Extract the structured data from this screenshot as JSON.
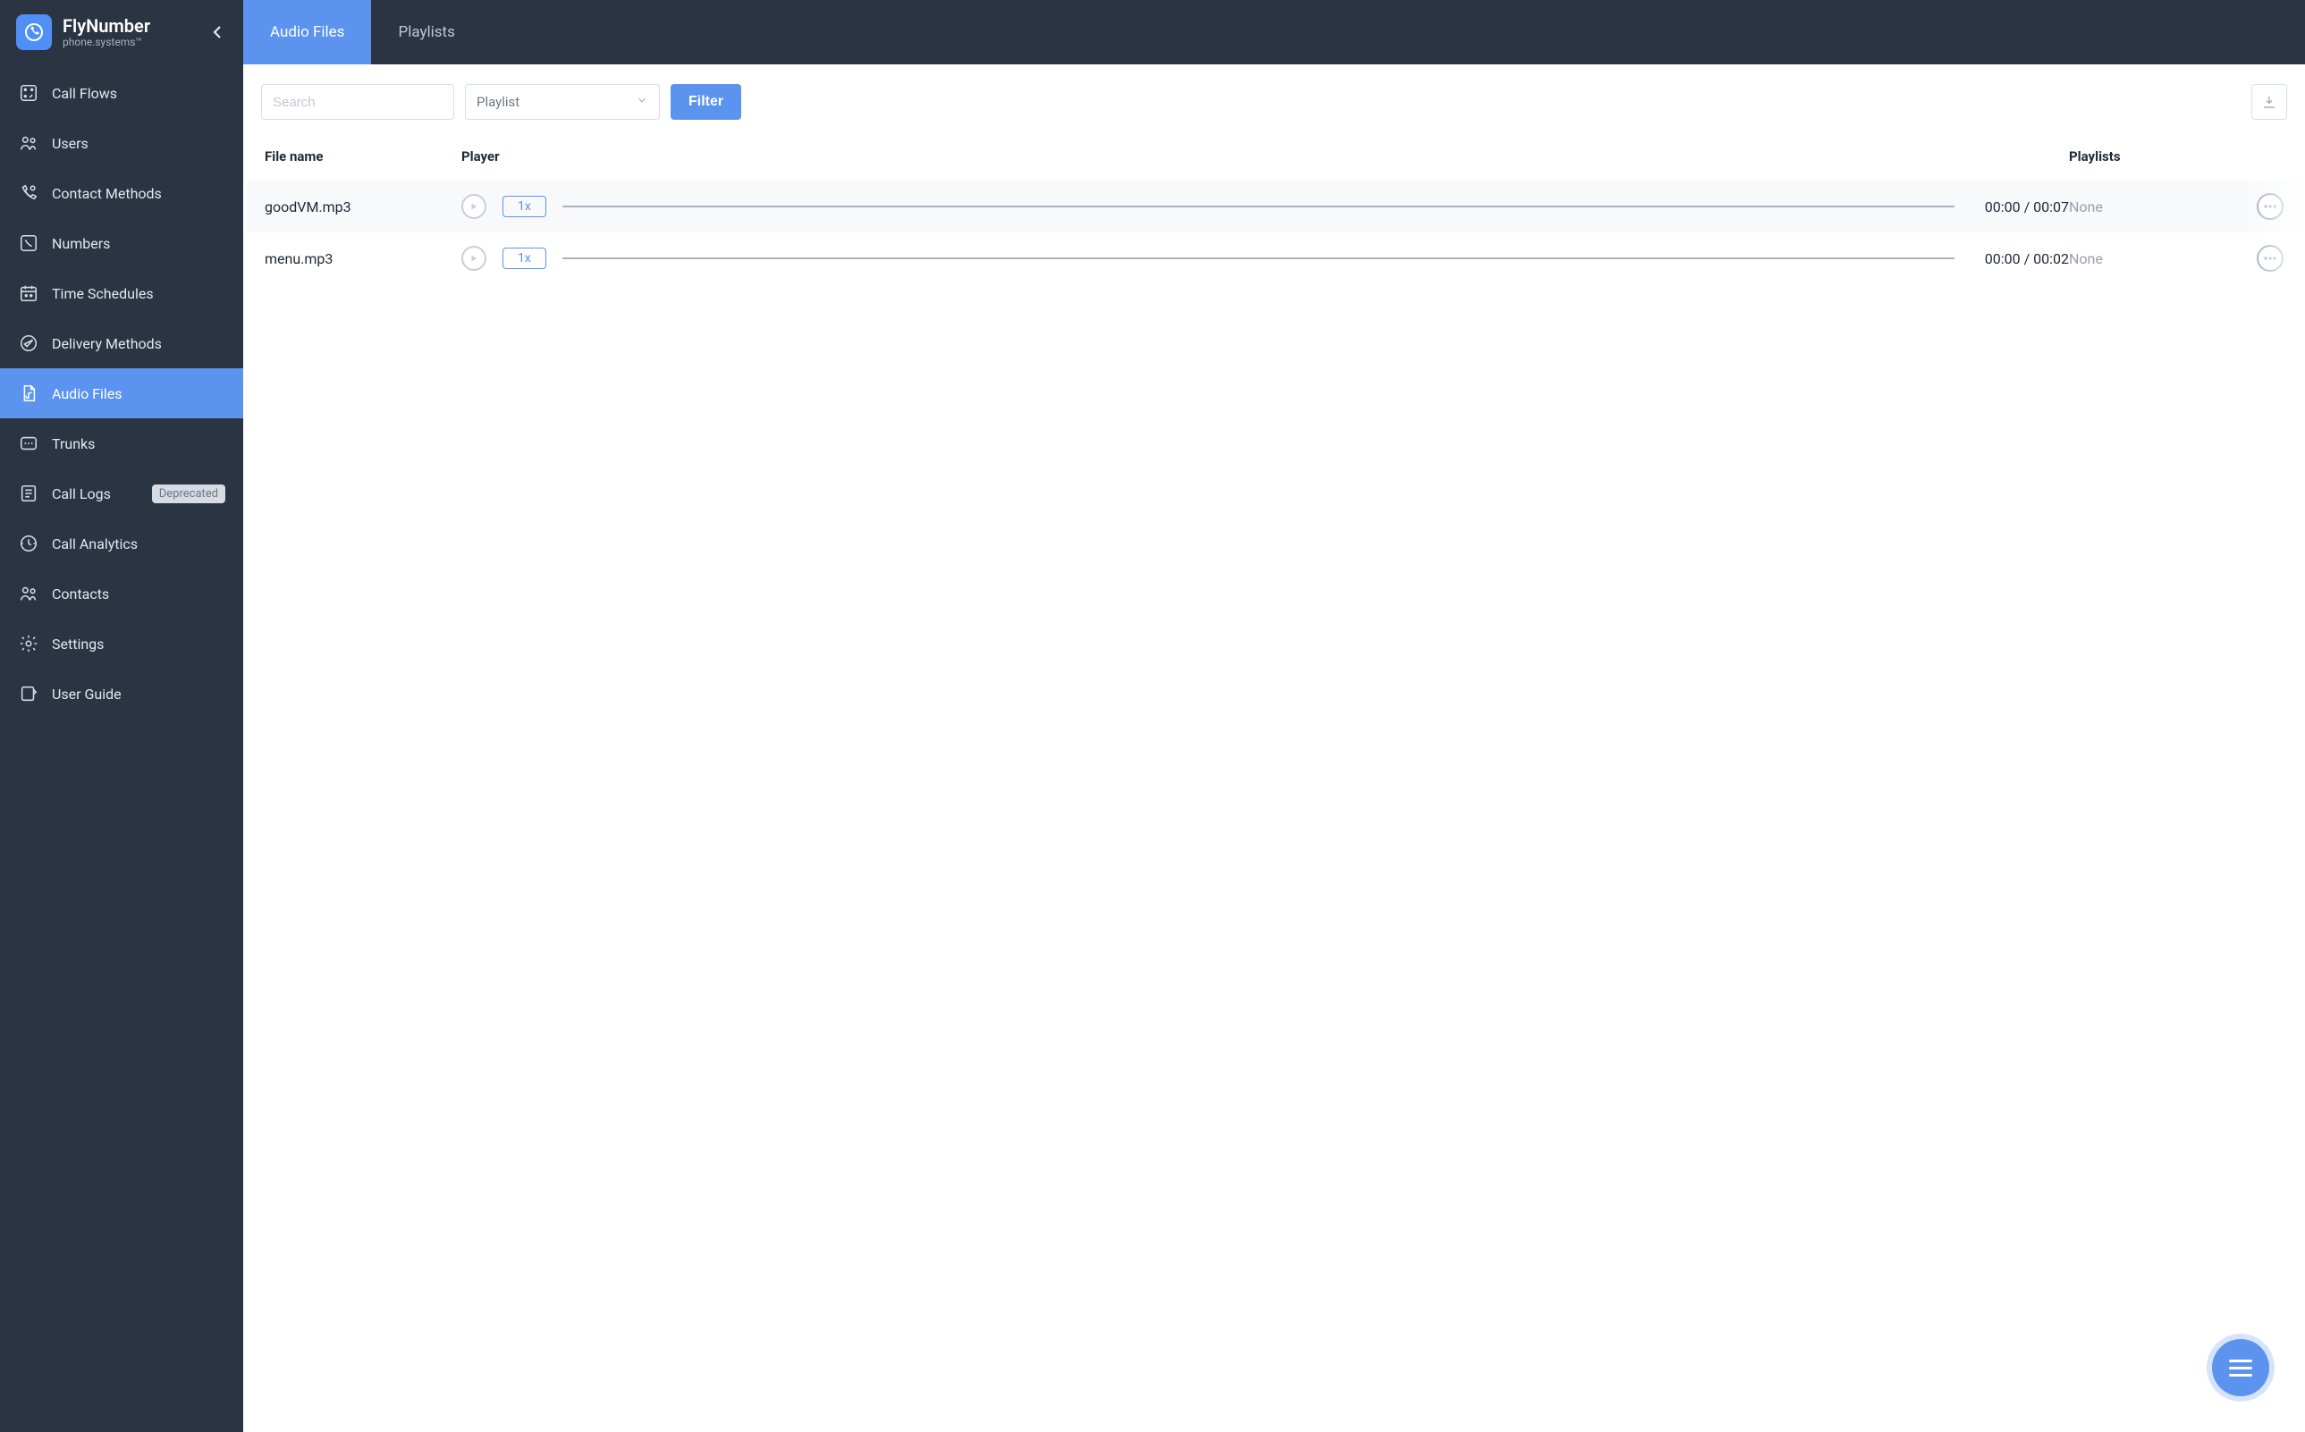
{
  "brand": {
    "title": "FlyNumber",
    "subtitle": "phone.systems™"
  },
  "sidebar": {
    "items": [
      {
        "label": "Call Flows",
        "icon": "call-flows"
      },
      {
        "label": "Users",
        "icon": "users"
      },
      {
        "label": "Contact Methods",
        "icon": "contact-methods"
      },
      {
        "label": "Numbers",
        "icon": "numbers"
      },
      {
        "label": "Time Schedules",
        "icon": "time-schedules"
      },
      {
        "label": "Delivery Methods",
        "icon": "delivery-methods"
      },
      {
        "label": "Audio Files",
        "icon": "audio-files",
        "active": true
      },
      {
        "label": "Trunks",
        "icon": "trunks"
      },
      {
        "label": "Call Logs",
        "icon": "call-logs",
        "badge": "Deprecated"
      },
      {
        "label": "Call Analytics",
        "icon": "call-analytics"
      },
      {
        "label": "Contacts",
        "icon": "contacts"
      },
      {
        "label": "Settings",
        "icon": "settings"
      },
      {
        "label": "User Guide",
        "icon": "user-guide"
      }
    ]
  },
  "tabs": [
    {
      "label": "Audio Files",
      "active": true
    },
    {
      "label": "Playlists",
      "active": false
    }
  ],
  "toolbar": {
    "search_placeholder": "Search",
    "playlist_select_label": "Playlist",
    "filter_label": "Filter"
  },
  "table": {
    "headers": {
      "file": "File name",
      "player": "Player",
      "playlists": "Playlists"
    },
    "rows": [
      {
        "file": "goodVM.mp3",
        "speed": "1x",
        "time_current": "00:00",
        "time_total": "00:07",
        "playlists": "None"
      },
      {
        "file": "menu.mp3",
        "speed": "1x",
        "time_current": "00:00",
        "time_total": "00:02",
        "playlists": "None"
      }
    ]
  }
}
